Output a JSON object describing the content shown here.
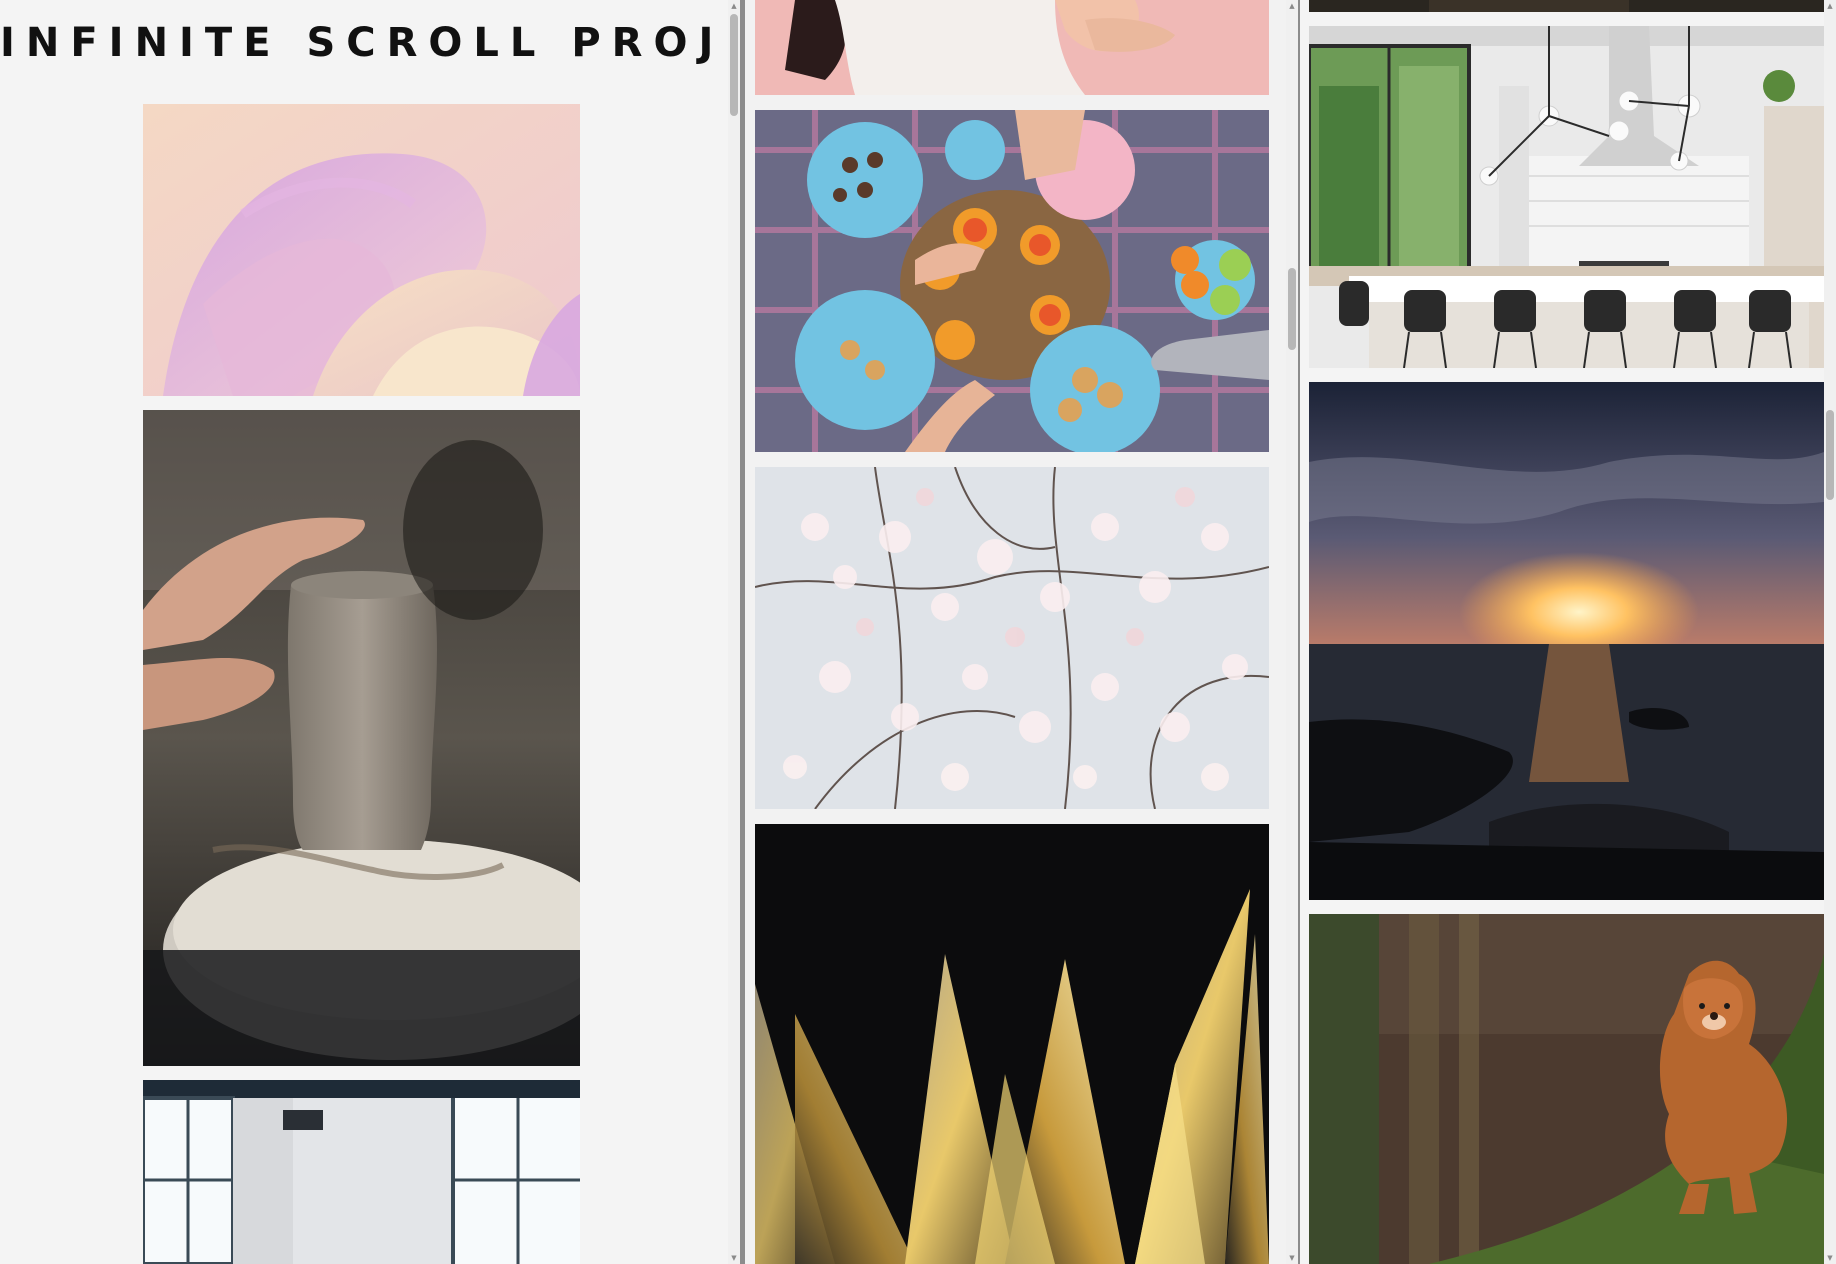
{
  "page": {
    "title": "INFINITE SCROLL PROJECT"
  },
  "columns": [
    {
      "name": "left-column",
      "images": [
        {
          "name": "pastel-abstract-shapes"
        },
        {
          "name": "pottery-vase-carving"
        },
        {
          "name": "bright-room-windows"
        }
      ]
    },
    {
      "name": "middle-column",
      "images": [
        {
          "name": "pink-dress-child-feet"
        },
        {
          "name": "picnic-table-overhead"
        },
        {
          "name": "cherry-blossom-branches"
        },
        {
          "name": "glass-crystal-spikes"
        }
      ]
    },
    {
      "name": "right-column",
      "images": [
        {
          "name": "dark-strip-photo"
        },
        {
          "name": "modern-kitchen-interior"
        },
        {
          "name": "ocean-sunset"
        },
        {
          "name": "dog-on-mossy-tree"
        }
      ]
    }
  ],
  "colors": {
    "page_background": "#f4f4f4",
    "divider": "#8c8c8c",
    "scrollbar_track": "#f0f0f0",
    "scrollbar_thumb": "#b7b7b7"
  }
}
